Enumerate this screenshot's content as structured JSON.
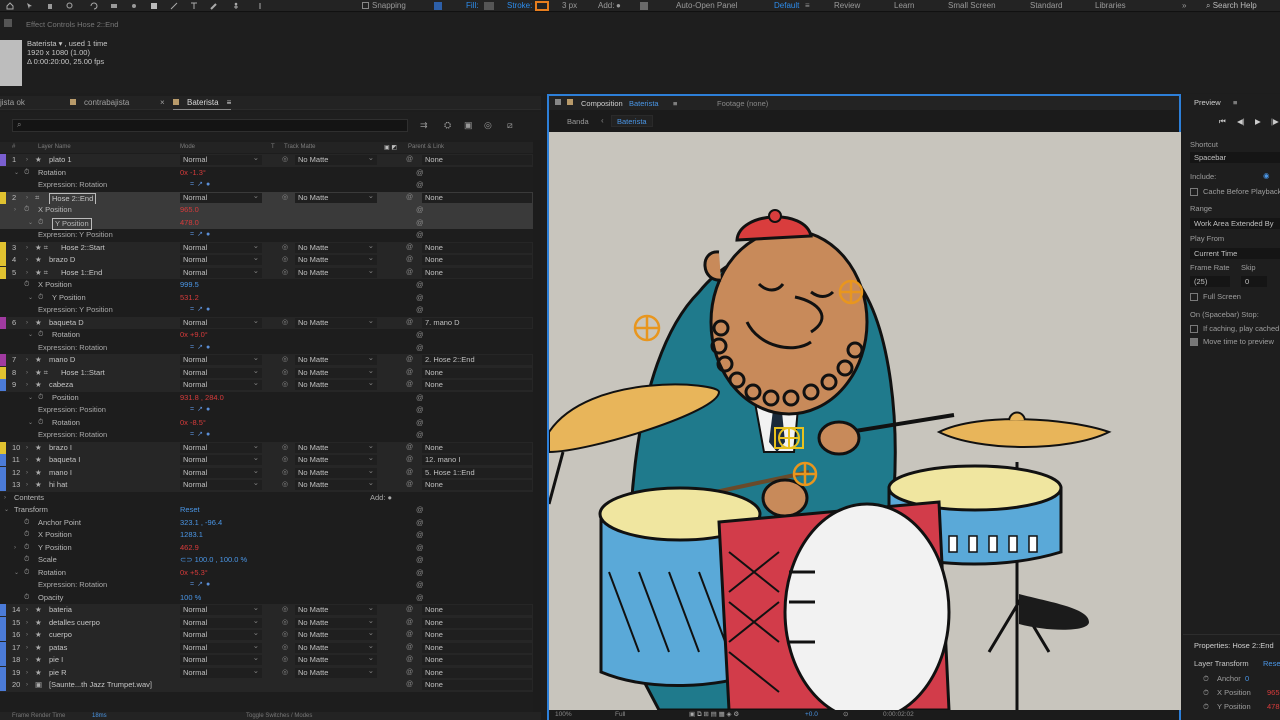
{
  "toolbar": {
    "snapping": "Snapping",
    "fill": "Fill:",
    "stroke": "Stroke:",
    "stroke_width": "3 px",
    "add": "Add:",
    "auto_open": "Auto-Open Panel",
    "workspaces": [
      "Default",
      "Review",
      "Learn",
      "Small Screen",
      "Standard",
      "Libraries"
    ],
    "search_help": "Search Help",
    "more": "»"
  },
  "effect_controls": {
    "title": "Effect Controls Hose 2::End",
    "item_name": "Baterista ▾ , used 1 time",
    "size": "1920 x 1080 (1.00)",
    "duration": "Δ 0:00:20:00, 25.00 fps"
  },
  "timeline": {
    "tabs": [
      {
        "label": "jista ok",
        "color": ""
      },
      {
        "label": "contrabajista",
        "color": "#b89a6a"
      },
      {
        "label": "Baterista",
        "color": "#b89a6a"
      }
    ],
    "menu_icon": "≡",
    "close_icon": "×",
    "search_placeholder": "⌕",
    "headers": {
      "num": "#",
      "layer_name": "Layer Name",
      "mode": "Mode",
      "t": "T",
      "track_matte": "Track Matte",
      "parent": "Parent & Link"
    },
    "bottom": {
      "render_time_label": "Frame Render Time",
      "render_time": "18ms",
      "toggle": "Toggle Switches / Modes"
    }
  },
  "rows": [
    {
      "kind": "layer",
      "num": "1",
      "name": "plato 1",
      "color": "#7a5fd0",
      "icon": "★",
      "mode": "Normal",
      "matte": "No Matte",
      "parent": "None"
    },
    {
      "kind": "prop",
      "name": "Rotation",
      "indent": 38,
      "value": "0x -1.3°",
      "vclass": "red",
      "tw": "⌄",
      "sw": "⏱"
    },
    {
      "kind": "expr",
      "name": "Expression: Rotation",
      "indent": 38
    },
    {
      "kind": "layer",
      "num": "2",
      "name": "Hose 2::End",
      "color": "#e0c230",
      "icon": "⌗",
      "mode": "Normal",
      "matte": "No Matte",
      "parent": "None",
      "selected": true,
      "boxed": true
    },
    {
      "kind": "prop",
      "name": "X Position",
      "indent": 38,
      "value": "965.0",
      "vclass": "red",
      "tw": "›",
      "sw": "⏱",
      "selected": true
    },
    {
      "kind": "prop",
      "name": "Y Position",
      "indent": 52,
      "value": "478.0",
      "vclass": "red",
      "tw": "⌄",
      "sw": "⏱",
      "selected": true,
      "boxed": true
    },
    {
      "kind": "expr",
      "name": "Expression: Y Position",
      "indent": 38
    },
    {
      "kind": "layer",
      "num": "3",
      "name": "Hose 2::Start",
      "color": "#e0c230",
      "icon": "★ ⌗",
      "mode": "Normal",
      "matte": "No Matte",
      "parent": "None"
    },
    {
      "kind": "layer",
      "num": "4",
      "name": "brazo D",
      "color": "#e0c230",
      "icon": "★",
      "mode": "Normal",
      "matte": "No Matte",
      "parent": "None"
    },
    {
      "kind": "layer",
      "num": "5",
      "name": "Hose 1::End",
      "color": "#e0c230",
      "icon": "★ ⌗",
      "mode": "Normal",
      "matte": "No Matte",
      "parent": "None"
    },
    {
      "kind": "prop",
      "name": "X Position",
      "indent": 38,
      "value": "999.5",
      "vclass": "blue",
      "tw": "",
      "sw": ""
    },
    {
      "kind": "prop",
      "name": "Y Position",
      "indent": 52,
      "value": "531.2",
      "vclass": "red",
      "tw": "⌄",
      "sw": "⏱"
    },
    {
      "kind": "expr",
      "name": "Expression: Y Position",
      "indent": 38
    },
    {
      "kind": "layer",
      "num": "6",
      "name": "baqueta D",
      "color": "#a03aa0",
      "icon": "★",
      "mode": "Normal",
      "matte": "No Matte",
      "parent": "7. mano D"
    },
    {
      "kind": "prop",
      "name": "Rotation",
      "indent": 52,
      "value": "0x +9.0°",
      "vclass": "red",
      "tw": "⌄",
      "sw": "⏱"
    },
    {
      "kind": "expr",
      "name": "Expression: Rotation",
      "indent": 38
    },
    {
      "kind": "layer",
      "num": "7",
      "name": "mano D",
      "color": "#a03aa0",
      "icon": "★",
      "mode": "Normal",
      "matte": "No Matte",
      "parent": "2. Hose 2::End"
    },
    {
      "kind": "layer",
      "num": "8",
      "name": "Hose 1::Start",
      "color": "#e0c230",
      "icon": "★ ⌗",
      "mode": "Normal",
      "matte": "No Matte",
      "parent": "None"
    },
    {
      "kind": "layer",
      "num": "9",
      "name": "cabeza",
      "color": "#4b7bd8",
      "icon": "★",
      "mode": "Normal",
      "matte": "No Matte",
      "parent": "None"
    },
    {
      "kind": "prop",
      "name": "Position",
      "indent": 52,
      "value": "931.8 , 284.0",
      "vclass": "red",
      "tw": "⌄",
      "sw": "⏱"
    },
    {
      "kind": "expr",
      "name": "Expression: Position",
      "indent": 38
    },
    {
      "kind": "prop",
      "name": "Rotation",
      "indent": 52,
      "value": "0x -8.5°",
      "vclass": "red",
      "tw": "⌄",
      "sw": "⏱"
    },
    {
      "kind": "expr",
      "name": "Expression: Rotation",
      "indent": 38
    },
    {
      "kind": "layer",
      "num": "10",
      "name": "brazo I",
      "color": "#e0c230",
      "icon": "★",
      "mode": "Normal",
      "matte": "No Matte",
      "parent": "None"
    },
    {
      "kind": "layer",
      "num": "11",
      "name": "baqueta I",
      "color": "#4b7bd8",
      "icon": "★",
      "mode": "Normal",
      "matte": "No Matte",
      "parent": "12. mano I"
    },
    {
      "kind": "layer",
      "num": "12",
      "name": "mano I",
      "color": "#4b7bd8",
      "icon": "★",
      "mode": "Normal",
      "matte": "No Matte",
      "parent": "5. Hose 1::End"
    },
    {
      "kind": "layer",
      "num": "13",
      "name": "hi hat",
      "color": "#4b7bd8",
      "icon": "★",
      "mode": "Normal",
      "matte": "No Matte",
      "parent": "None"
    },
    {
      "kind": "group",
      "name": "Contents",
      "indent": 14,
      "extra": "Add: ●"
    },
    {
      "kind": "group",
      "name": "Transform",
      "indent": 14,
      "extra": "Reset"
    },
    {
      "kind": "prop",
      "name": "Anchor Point",
      "indent": 38,
      "value": "323.1 , -96.4",
      "vclass": "blue",
      "tw": "",
      "sw": ""
    },
    {
      "kind": "prop",
      "name": "X Position",
      "indent": 38,
      "value": "1283.1",
      "vclass": "blue",
      "tw": "",
      "sw": ""
    },
    {
      "kind": "prop",
      "name": "Y Position",
      "indent": 38,
      "value": "462.9",
      "vclass": "red",
      "tw": "›",
      "sw": ""
    },
    {
      "kind": "prop",
      "name": "Scale",
      "indent": 38,
      "value": "⊂⊃ 100.0 , 100.0 %",
      "vclass": "blue",
      "tw": "",
      "sw": ""
    },
    {
      "kind": "prop",
      "name": "Rotation",
      "indent": 38,
      "value": "0x +5.3°",
      "vclass": "red",
      "tw": "⌄",
      "sw": ""
    },
    {
      "kind": "expr",
      "name": "Expression: Rotation",
      "indent": 38
    },
    {
      "kind": "prop",
      "name": "Opacity",
      "indent": 38,
      "value": "100 %",
      "vclass": "blue",
      "tw": "",
      "sw": ""
    },
    {
      "kind": "layer",
      "num": "14",
      "name": "bateria",
      "color": "#4b7bd8",
      "icon": "★",
      "mode": "Normal",
      "matte": "No Matte",
      "parent": "None"
    },
    {
      "kind": "layer",
      "num": "15",
      "name": "detalles cuerpo",
      "color": "#4b7bd8",
      "icon": "★",
      "mode": "Normal",
      "matte": "No Matte",
      "parent": "None"
    },
    {
      "kind": "layer",
      "num": "16",
      "name": "cuerpo",
      "color": "#4b7bd8",
      "icon": "★",
      "mode": "Normal",
      "matte": "No Matte",
      "parent": "None"
    },
    {
      "kind": "layer",
      "num": "17",
      "name": "patas",
      "color": "#4b7bd8",
      "icon": "★",
      "mode": "Normal",
      "matte": "No Matte",
      "parent": "None"
    },
    {
      "kind": "layer",
      "num": "18",
      "name": "pie I",
      "color": "#4b7bd8",
      "icon": "★",
      "mode": "Normal",
      "matte": "No Matte",
      "parent": "None"
    },
    {
      "kind": "layer",
      "num": "19",
      "name": "pie R",
      "color": "#4b7bd8",
      "icon": "★",
      "mode": "Normal",
      "matte": "No Matte",
      "parent": "None"
    },
    {
      "kind": "layer",
      "num": "20",
      "name": "[Saunte...th Jazz Trumpet.wav]",
      "color": "#4b7bd8",
      "icon": "▣",
      "mode": "",
      "matte": "",
      "parent": "None"
    }
  ],
  "composition": {
    "tab_label": "Composition",
    "tab_comp": "Baterista",
    "footage_tab": "Footage (none)",
    "crumb_1": "Banda",
    "crumb_2": "Baterista",
    "zoom": "100%",
    "resolution": "Full",
    "exposure": "+0.0",
    "timecode": "0:00:02:02"
  },
  "preview": {
    "title": "Preview",
    "shortcut_label": "Shortcut",
    "shortcut_value": "Spacebar",
    "include_label": "Include:",
    "cache_before": "Cache Before Playback",
    "range_label": "Range",
    "range_value": "Work Area Extended By",
    "play_from_label": "Play From",
    "play_from_value": "Current Time",
    "frame_rate_label": "Frame Rate",
    "skip_label": "Skip",
    "frame_rate_value": "(25)",
    "skip_value": "0",
    "full_screen": "Full Screen",
    "on_stop": "On (Spacebar) Stop:",
    "if_caching": "If caching, play cached",
    "move_time": "Move time to preview",
    "properties_title": "Properties: Hose 2::End",
    "layer_transform": "Layer Transform",
    "reset": "Reset",
    "anchor": "Anchor",
    "anchor_value": "0",
    "xpos": "X Position",
    "xpos_value": "965",
    "ypos": "Y Position",
    "ypos_value": "478"
  },
  "colors": {
    "accent": "#2d8ceb",
    "keyframe_red": "#d73b3b",
    "value_blue": "#4a96e6"
  }
}
